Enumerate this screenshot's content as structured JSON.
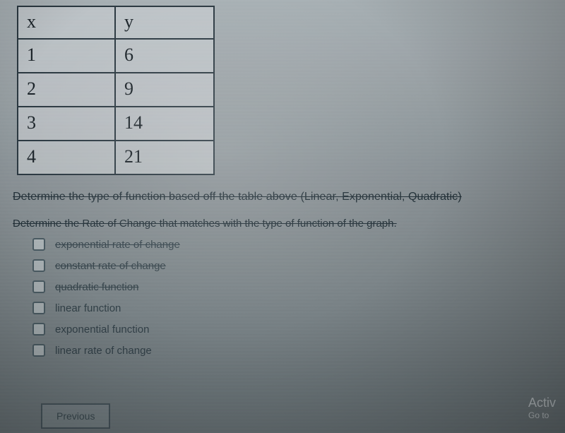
{
  "table": {
    "headers": {
      "x": "x",
      "y": "y"
    },
    "rows": [
      {
        "x": "1",
        "y": "6"
      },
      {
        "x": "2",
        "y": "9"
      },
      {
        "x": "3",
        "y": "14"
      },
      {
        "x": "4",
        "y": "21"
      }
    ]
  },
  "prompts": {
    "p1": "Determine the type of function based off the table above (Linear, Exponential, Quadratic)",
    "p2": "Determine the Rate of Change that matches with the type of function of the graph."
  },
  "options": [
    {
      "label": "exponential rate of change",
      "struck": true
    },
    {
      "label": "constant rate of change",
      "struck": true
    },
    {
      "label": "quadratic function",
      "struck": true
    },
    {
      "label": "linear function",
      "struck": false
    },
    {
      "label": "exponential function",
      "struck": false
    },
    {
      "label": "linear rate of change",
      "struck": false
    }
  ],
  "buttons": {
    "previous": "Previous"
  },
  "watermark": {
    "line1": "Activ",
    "line2": "Go to"
  }
}
